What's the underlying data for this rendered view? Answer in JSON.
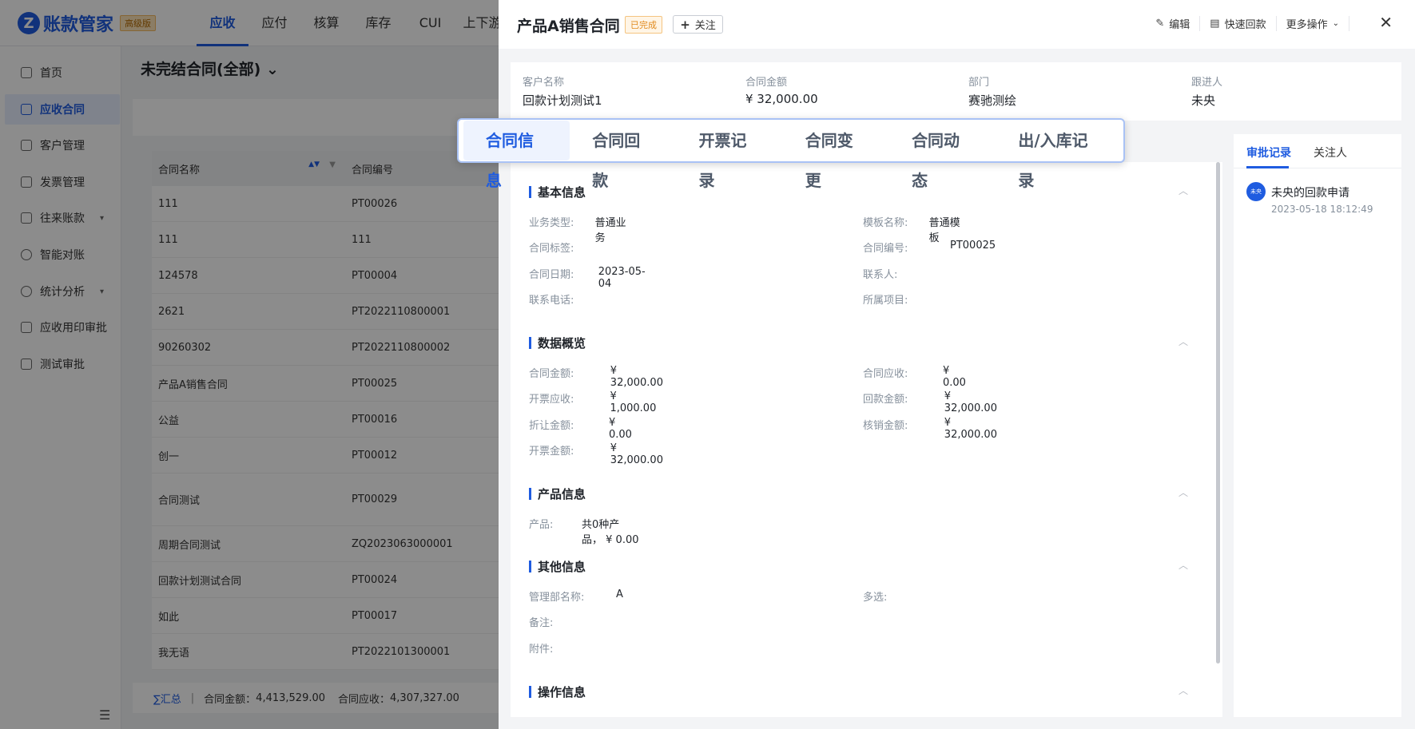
{
  "app": {
    "logo_mark": "Z",
    "logo_text": "账款管家",
    "edition_badge": "高级版",
    "top_nav": [
      "应收",
      "应付",
      "核算",
      "库存",
      "CUI",
      "上下游"
    ]
  },
  "sidebar": {
    "items": [
      {
        "label": "首页"
      },
      {
        "label": "应收合同"
      },
      {
        "label": "客户管理"
      },
      {
        "label": "发票管理"
      },
      {
        "label": "往来账款"
      },
      {
        "label": "智能对账"
      },
      {
        "label": "统计分析"
      },
      {
        "label": "应收用印审批"
      },
      {
        "label": "测试审批"
      }
    ]
  },
  "list": {
    "title": "未完结合同(全部) ⌄",
    "columns": [
      "合同名称",
      "合同编号"
    ],
    "rows": [
      {
        "name": "111",
        "code": "PT00026"
      },
      {
        "name": "111",
        "code": "111"
      },
      {
        "name": "124578",
        "code": "PT00004"
      },
      {
        "name": "2621",
        "code": "PT2022110800001"
      },
      {
        "name": "90260302",
        "code": "PT2022110800002"
      },
      {
        "name": "产品A销售合同",
        "code": "PT00025"
      },
      {
        "name": "公益",
        "code": "PT00016"
      },
      {
        "name": "创一",
        "code": "PT00012"
      },
      {
        "name": "合同测试",
        "code": "PT00029"
      },
      {
        "name": "周期合同测试",
        "code": "ZQ2023063000001"
      },
      {
        "name": "回款计划测试合同",
        "code": "PT00024"
      },
      {
        "name": "如此",
        "code": "PT00017"
      },
      {
        "name": "我无语",
        "code": "PT2022101300001"
      }
    ],
    "summary": {
      "label": "∑汇总",
      "amount_label": "合同金额：",
      "amount_value": "4,413,529.00",
      "receivable_label": "合同应收：",
      "receivable_value": "4,307,327.00"
    }
  },
  "drawer": {
    "title": "产品A销售合同",
    "status": "已完成",
    "follow_label": "关注",
    "actions": {
      "edit": "编辑",
      "quick_payment": "快速回款",
      "more": "更多操作"
    },
    "summary": [
      {
        "label": "客户名称",
        "value": "回款计划测试1"
      },
      {
        "label": "合同金额",
        "value": "¥ 32,000.00"
      },
      {
        "label": "部门",
        "value": "赛驰测绘"
      },
      {
        "label": "跟进人",
        "value": "未央"
      }
    ],
    "tabs": [
      "合同信息",
      "合同回款",
      "开票记录",
      "合同变更",
      "合同动态",
      "出/入库记录"
    ],
    "sections": {
      "basic": {
        "title": "基本信息",
        "fields": {
          "biz_type_label": "业务类型:",
          "biz_type_value": "普通业务",
          "template_label": "模板名称:",
          "template_value": "普通模板",
          "tag_label": "合同标签:",
          "tag_value": "",
          "code_label": "合同编号:",
          "code_value": "PT00025",
          "date_label": "合同日期:",
          "date_value": "2023-05-04",
          "contact_label": "联系人:",
          "contact_value": "",
          "phone_label": "联系电话:",
          "phone_value": "",
          "project_label": "所属项目:",
          "project_value": ""
        }
      },
      "overview": {
        "title": "数据概览",
        "fields": {
          "amount_label": "合同金额:",
          "amount_value": "¥ 32,000.00",
          "receivable_label": "合同应收:",
          "receivable_value": "¥ 0.00",
          "invoice_recv_label": "开票应收:",
          "invoice_recv_value": "¥ 1,000.00",
          "paid_label": "回款金额:",
          "paid_value": "¥ 32,000.00",
          "discount_label": "折让金额:",
          "discount_value": "¥ 0.00",
          "writeoff_label": "核销金额:",
          "writeoff_value": "¥ 32,000.00",
          "invoiced_label": "开票金额:",
          "invoiced_value": "¥ 32,000.00"
        }
      },
      "product": {
        "title": "产品信息",
        "fields": {
          "product_label": "产品:",
          "product_value": "共0种产品， ¥ 0.00"
        }
      },
      "other": {
        "title": "其他信息",
        "fields": {
          "dept_label": "管理部名称:",
          "dept_value": "A",
          "multi_label": "多选:",
          "multi_value": "",
          "remark_label": "备注:",
          "remark_value": "",
          "attach_label": "附件:",
          "attach_value": ""
        }
      },
      "ops": {
        "title": "操作信息"
      }
    },
    "side_panel": {
      "tabs": [
        "审批记录",
        "关注人"
      ],
      "records": [
        {
          "avatar": "未央",
          "title": "未央的回款申请",
          "time": "2023-05-18 18:12:49"
        }
      ]
    }
  },
  "colors": {
    "accent": "#1f5ce0",
    "status_done": "#e08a1e"
  }
}
